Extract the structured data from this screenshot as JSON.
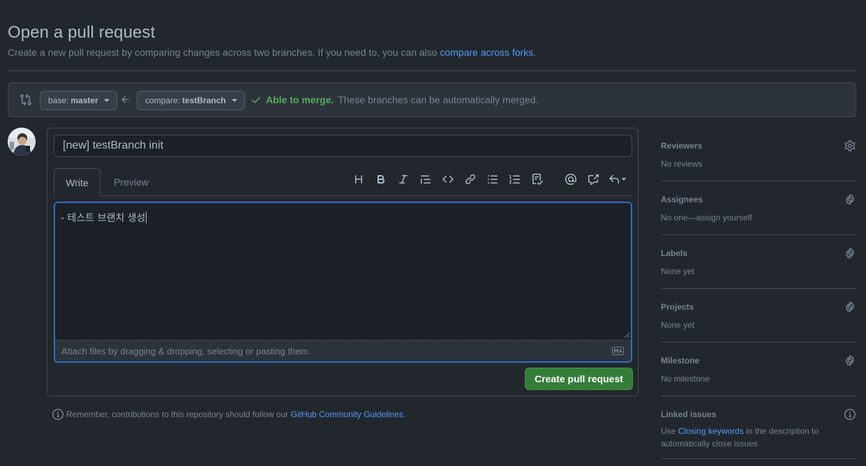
{
  "header": {
    "title": "Open a pull request",
    "subtitle": "Create a new pull request by comparing changes across two branches. If you need to, you can also ",
    "subtitle_link": "compare across forks",
    "subtitle_end": "."
  },
  "range": {
    "base_prefix": "base: ",
    "base_branch": "master",
    "compare_prefix": "compare: ",
    "compare_branch": "testBranch",
    "merge_ok": "Able to merge.",
    "merge_rest": "These branches can be automatically merged."
  },
  "form": {
    "title_value": "[new] testBranch init",
    "tabs": [
      "Write",
      "Preview"
    ],
    "body_value": "- 테스트 브랜치 생성",
    "attach_hint": "Attach files by dragging & dropping, selecting or pasting them.",
    "submit_label": "Create pull request",
    "toolbar_icons": [
      "heading-icon",
      "bold-icon",
      "italic-icon",
      "quote-icon",
      "code-icon",
      "link-icon",
      "unordered-list-icon",
      "ordered-list-icon",
      "task-list-icon",
      "mention-icon",
      "cross-reference-icon",
      "saved-replies-icon"
    ]
  },
  "footer": {
    "remember_text": "Remember, contributions to this repository should follow our ",
    "remember_link": "GitHub Community Guidelines",
    "remember_end": "."
  },
  "sidebar": {
    "reviewers": {
      "title": "Reviewers",
      "value": "No reviews"
    },
    "assignees": {
      "title": "Assignees",
      "value": "No one—assign yourself"
    },
    "labels": {
      "title": "Labels",
      "value": "None yet"
    },
    "projects": {
      "title": "Projects",
      "value": "None yet"
    },
    "milestone": {
      "title": "Milestone",
      "value": "No milestone"
    },
    "linked": {
      "title": "Linked issues",
      "value_pre": "Use ",
      "value_link": "Closing keywords",
      "value_post": " in the description to automatically close issues"
    }
  },
  "colors": {
    "background": "#22272e",
    "panel": "#2d333b",
    "border": "#444c56",
    "link": "#539bf5",
    "success": "#57ab5a",
    "primary_button": "#347d39",
    "focus": "#316dca"
  }
}
